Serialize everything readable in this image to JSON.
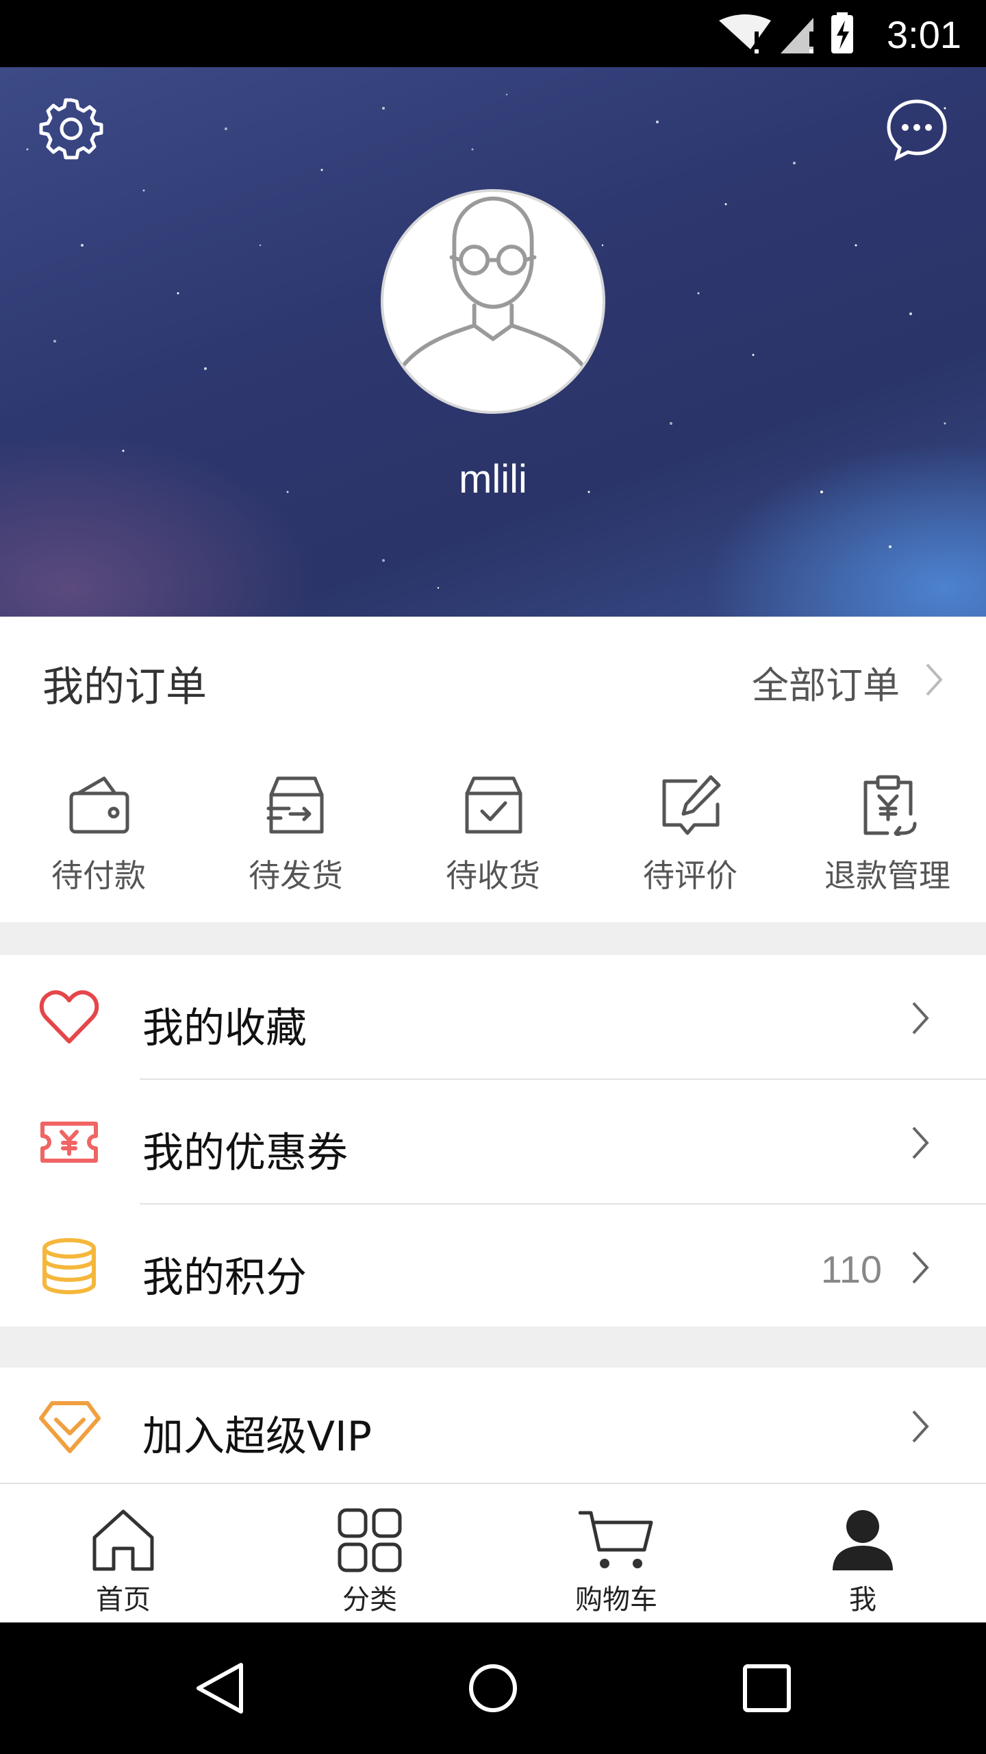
{
  "status_bar": {
    "time": "3:01"
  },
  "profile": {
    "username": "mlili"
  },
  "orders": {
    "title": "我的订单",
    "all_label": "全部订单",
    "items": [
      {
        "label": "待付款",
        "icon": "wallet-icon"
      },
      {
        "label": "待发货",
        "icon": "box-ship-icon"
      },
      {
        "label": "待收货",
        "icon": "box-check-icon"
      },
      {
        "label": "待评价",
        "icon": "edit-comment-icon"
      },
      {
        "label": "退款管理",
        "icon": "refund-clipboard-icon"
      }
    ]
  },
  "menu": [
    {
      "label": "我的收藏",
      "icon": "heart-icon",
      "value": ""
    },
    {
      "label": "我的优惠券",
      "icon": "coupon-icon",
      "value": ""
    },
    {
      "label": "我的积分",
      "icon": "coins-icon",
      "value": "110"
    }
  ],
  "vip": {
    "label": "加入超级VIP",
    "icon": "diamond-icon"
  },
  "tabs": [
    {
      "label": "首页",
      "icon": "home-icon"
    },
    {
      "label": "分类",
      "icon": "grid-icon"
    },
    {
      "label": "购物车",
      "icon": "cart-icon"
    },
    {
      "label": "我",
      "icon": "person-icon"
    }
  ],
  "colors": {
    "heart": "#e5464a",
    "coupon": "#f06464",
    "coins": "#f5b73b",
    "diamond": "#f0a040"
  }
}
